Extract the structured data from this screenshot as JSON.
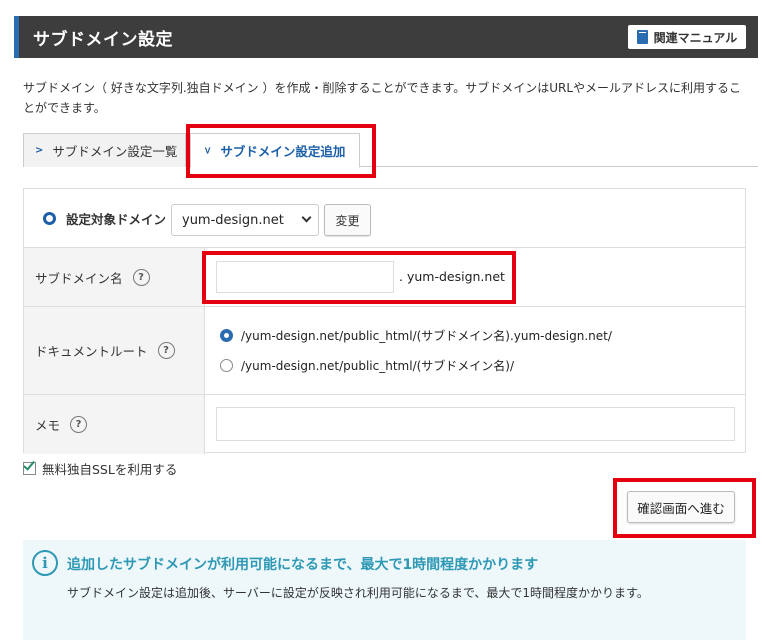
{
  "header": {
    "title": "サブドメイン設定",
    "manual_label": "関連マニュアル"
  },
  "description": "サブドメイン（ 好きな文字列.独自ドメイン ）を作成・削除することができます。サブドメインはURLやメールアドレスに利用することができます。",
  "tabs": [
    {
      "label": "サブドメイン設定一覧",
      "active": false
    },
    {
      "label": "サブドメイン設定追加",
      "active": true
    }
  ],
  "form": {
    "domain_label": "設定対象ドメイン",
    "domain_selected": "yum-design.net",
    "change_label": "変更",
    "subdomain_label": "サブドメイン名",
    "subdomain_value": "",
    "subdomain_suffix": ". yum-design.net",
    "docroot_label": "ドキュメントルート",
    "docroot_options": [
      {
        "label": "/yum-design.net/public_html/(サブドメイン名).yum-design.net/",
        "selected": true
      },
      {
        "label": "/yum-design.net/public_html/(サブドメイン名)/",
        "selected": false
      }
    ],
    "memo_label": "メモ",
    "memo_value": "",
    "help_glyph": "?"
  },
  "ssl": {
    "label": "無料独自SSLを利用する",
    "checked": true
  },
  "confirm_label": "確認画面へ進む",
  "info": {
    "glyph": "i",
    "title": "追加したサブドメインが利用可能になるまで、最大で1時間程度かかります",
    "body": "サブドメイン設定は追加後、サーバーに設定が反映され利用可能になるまで、最大で1時間程度かかります。"
  },
  "colors": {
    "header_bg": "#3d3d3d",
    "accent_blue": "#1a5fa8",
    "highlight_red": "#e4000f",
    "info_bg": "#eef8fb",
    "info_accent": "#2e98b5"
  }
}
